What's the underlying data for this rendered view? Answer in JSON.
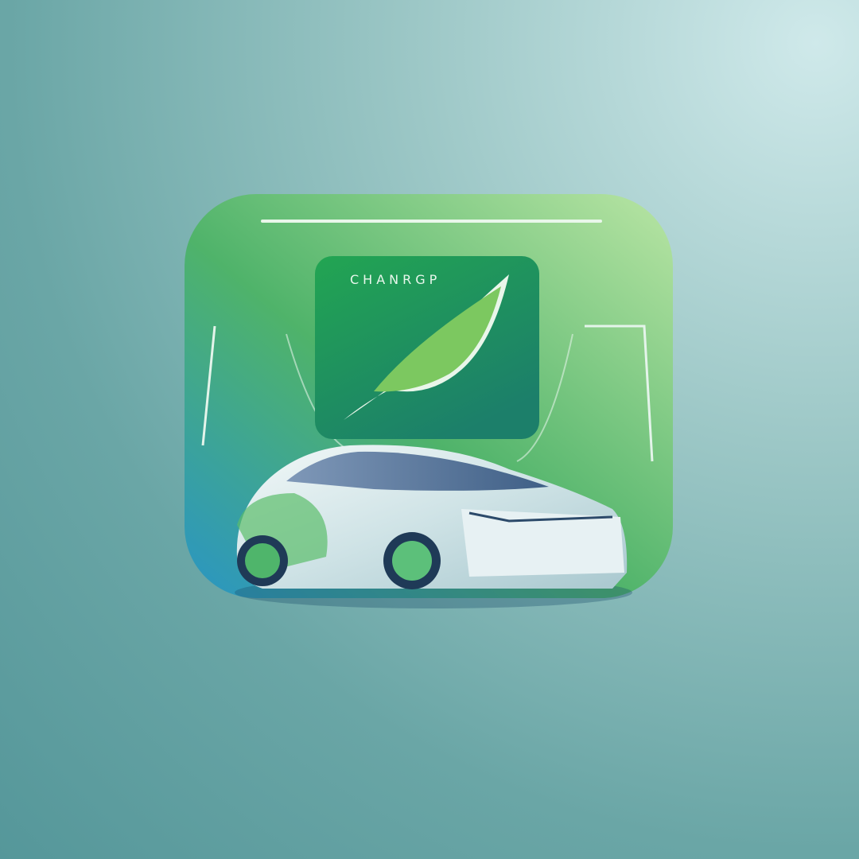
{
  "icon": {
    "label": "CHANRGP",
    "colors": {
      "background": "#8fbfbe",
      "tile_green": "#6cc35a",
      "tile_blue": "#2b9bc0",
      "inner_panel": "#1fa25a",
      "car_body": "#e6f0f2",
      "leaf": "#7cc860"
    },
    "icons": [
      "app-tile",
      "leaf-icon",
      "electric-car-icon"
    ]
  }
}
